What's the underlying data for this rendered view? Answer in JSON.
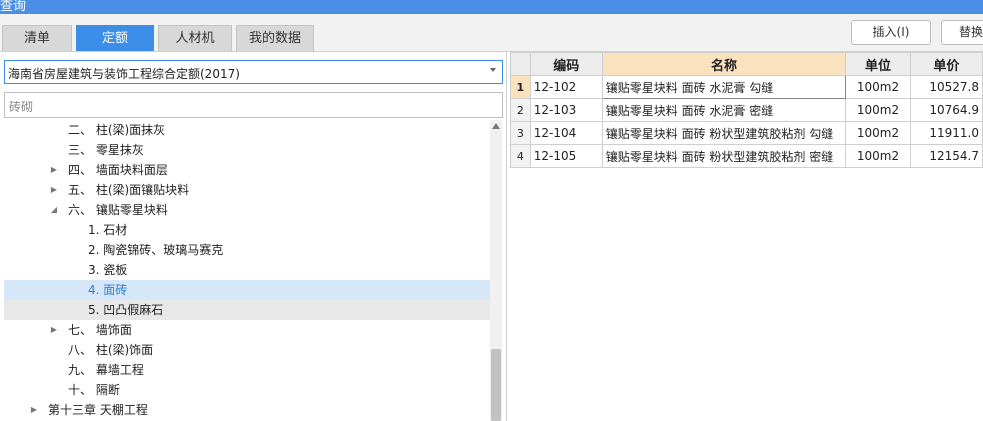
{
  "window": {
    "title": "查询"
  },
  "tabs": [
    {
      "label": "清单",
      "active": false
    },
    {
      "label": "定额",
      "active": true
    },
    {
      "label": "人材机",
      "active": false
    },
    {
      "label": "我的数据",
      "active": false
    }
  ],
  "toolbar": {
    "insert_label": "插入(I)",
    "replace_label": "替换"
  },
  "left": {
    "quota_library": "海南省房屋建筑与装饰工程综合定额(2017)",
    "search_value": "砖砌"
  },
  "tree": [
    {
      "text": "二、 柱(梁)面抹灰",
      "level": 2,
      "expander": "none"
    },
    {
      "text": "三、 零星抹灰",
      "level": 2,
      "expander": "none"
    },
    {
      "text": "四、 墙面块料面层",
      "level": 2,
      "expander": "collapsed"
    },
    {
      "text": "五、 柱(梁)面镶贴块料",
      "level": 2,
      "expander": "collapsed"
    },
    {
      "text": "六、 镶贴零星块料",
      "level": 2,
      "expander": "expanded"
    },
    {
      "text": "1. 石材",
      "level": 3,
      "expander": "none"
    },
    {
      "text": "2. 陶瓷锦砖、玻璃马赛克",
      "level": 3,
      "expander": "none"
    },
    {
      "text": "3. 瓷板",
      "level": 3,
      "expander": "none"
    },
    {
      "text": "4. 面砖",
      "level": 3,
      "expander": "none",
      "state": "selected"
    },
    {
      "text": "5. 凹凸假麻石",
      "level": 3,
      "expander": "none",
      "state": "hover"
    },
    {
      "text": "七、 墙饰面",
      "level": 2,
      "expander": "collapsed"
    },
    {
      "text": "八、 柱(梁)饰面",
      "level": 2,
      "expander": "none"
    },
    {
      "text": "九、 幕墙工程",
      "level": 2,
      "expander": "none"
    },
    {
      "text": "十、 隔断",
      "level": 2,
      "expander": "none"
    },
    {
      "text": "第十三章 天棚工程",
      "level": 1,
      "expander": "collapsed"
    }
  ],
  "grid": {
    "columns": [
      "编码",
      "名称",
      "单位",
      "单价"
    ],
    "rows": [
      {
        "idx": "1",
        "code": "12-102",
        "name": "镶贴零星块料 面砖 水泥膏 勾缝",
        "unit": "100m2",
        "price": "10527.8"
      },
      {
        "idx": "2",
        "code": "12-103",
        "name": "镶贴零星块料 面砖 水泥膏 密缝",
        "unit": "100m2",
        "price": "10764.9"
      },
      {
        "idx": "3",
        "code": "12-104",
        "name": "镶贴零星块料 面砖 粉状型建筑胶粘剂 勾缝",
        "unit": "100m2",
        "price": "11911.0"
      },
      {
        "idx": "4",
        "code": "12-105",
        "name": "镶贴零星块料 面砖 粉状型建筑胶粘剂 密缝",
        "unit": "100m2",
        "price": "12154.7"
      }
    ]
  },
  "colors": {
    "accent": "#3c8ee8",
    "selected_row_bg": "#d5e7f8",
    "header_highlight": "#fbe2bf"
  },
  "icons": {
    "expand_collapsed": "triangle-right-icon",
    "expand_open": "triangle-down-icon",
    "dropdown": "chevron-down-icon"
  }
}
